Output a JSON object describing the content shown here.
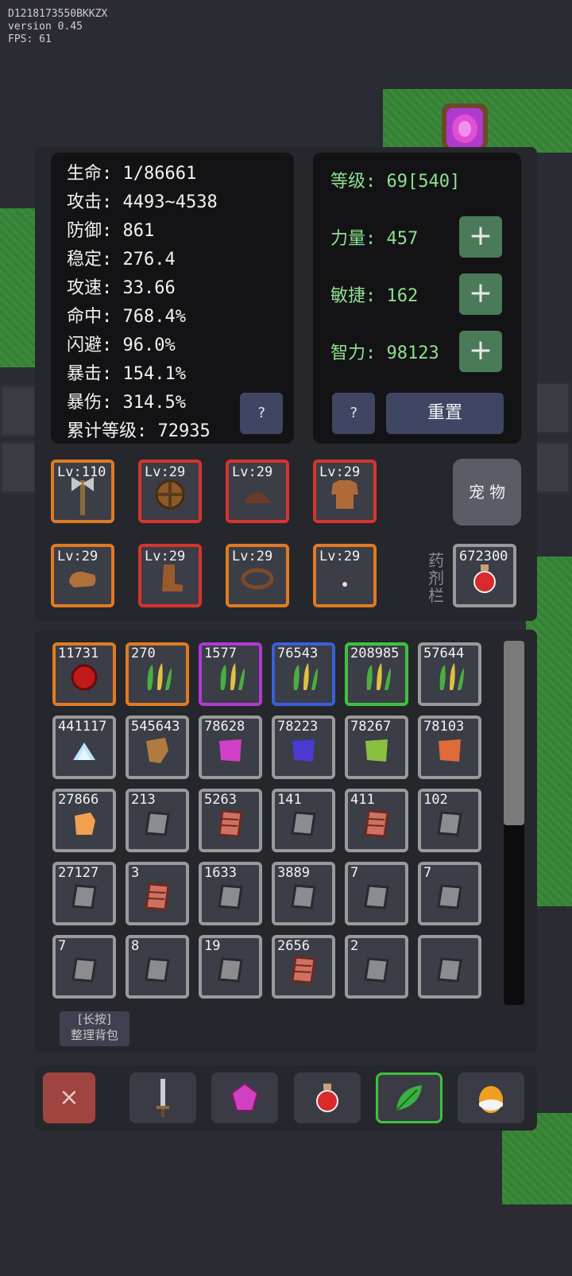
{
  "debug": {
    "line1": "D1218173550BKKZX",
    "line2": "version 0.45",
    "line3": "FPS: 61"
  },
  "stats": {
    "hp": "生命: 1/86661",
    "attack": "攻击: 4493~4538",
    "defense": "防御: 861",
    "stability": "稳定: 276.4",
    "attack_speed": "攻速: 33.66",
    "hit": "命中: 768.4%",
    "dodge": "闪避: 96.0%",
    "crit": "暴击: 154.1%",
    "crit_damage": "暴伤: 314.5%",
    "total_level": "累计等级: 72935",
    "help_label": "?"
  },
  "attributes": {
    "level": "等级: 69[540]",
    "strength": "力量: 457",
    "agility": "敏捷: 162",
    "intelligence": "智力: 98123",
    "plus_label": "+",
    "help_label": "?",
    "reset_label": "重置"
  },
  "equipment": [
    {
      "lv": "Lv:110",
      "icon": "axe-icon",
      "rarity": "orange"
    },
    {
      "lv": "Lv:29",
      "icon": "shield-icon",
      "rarity": "red"
    },
    {
      "lv": "Lv:29",
      "icon": "helmet-icon",
      "rarity": "red"
    },
    {
      "lv": "Lv:29",
      "icon": "armor-icon",
      "rarity": "red"
    },
    {
      "lv": "Lv:29",
      "icon": "glove-icon",
      "rarity": "orange"
    },
    {
      "lv": "Lv:29",
      "icon": "boot-icon",
      "rarity": "red"
    },
    {
      "lv": "Lv:29",
      "icon": "ring-icon",
      "rarity": "orange"
    },
    {
      "lv": "Lv:29",
      "icon": "necklace-icon",
      "rarity": "orange"
    }
  ],
  "pet_label": "宠 物",
  "potion_label": "药剂栏",
  "potion_count": "672300",
  "inventory": [
    {
      "count": "11731",
      "icon": "red-orb-icon",
      "rarity": "orange"
    },
    {
      "count": "270",
      "icon": "herb-icon",
      "rarity": "orange"
    },
    {
      "count": "1577",
      "icon": "herb-icon",
      "rarity": "purple"
    },
    {
      "count": "76543",
      "icon": "herb-icon",
      "rarity": "blue"
    },
    {
      "count": "208985",
      "icon": "herb-icon",
      "rarity": "green"
    },
    {
      "count": "57644",
      "icon": "herb-icon",
      "rarity": "gray"
    },
    {
      "count": "441117",
      "icon": "powder-icon",
      "rarity": "gray"
    },
    {
      "count": "545643",
      "icon": "leather-icon",
      "rarity": "gray"
    },
    {
      "count": "78628",
      "icon": "cloth-pink-icon",
      "rarity": "gray"
    },
    {
      "count": "78223",
      "icon": "cloth-blue-icon",
      "rarity": "gray"
    },
    {
      "count": "78267",
      "icon": "cloth-green-icon",
      "rarity": "gray"
    },
    {
      "count": "78103",
      "icon": "cloth-orange-icon",
      "rarity": "gray"
    },
    {
      "count": "27866",
      "icon": "ore-icon",
      "rarity": "gray"
    },
    {
      "count": "213",
      "icon": "stone-icon",
      "rarity": "gray"
    },
    {
      "count": "5263",
      "icon": "brick-icon",
      "rarity": "gray"
    },
    {
      "count": "141",
      "icon": "stone-icon",
      "rarity": "gray"
    },
    {
      "count": "411",
      "icon": "brick-icon",
      "rarity": "gray"
    },
    {
      "count": "102",
      "icon": "stone-icon",
      "rarity": "gray"
    },
    {
      "count": "27127",
      "icon": "stone-icon",
      "rarity": "gray"
    },
    {
      "count": "3",
      "icon": "brick-icon",
      "rarity": "gray"
    },
    {
      "count": "1633",
      "icon": "stone-icon",
      "rarity": "gray"
    },
    {
      "count": "3889",
      "icon": "stone-icon",
      "rarity": "gray"
    },
    {
      "count": "7",
      "icon": "stone-icon",
      "rarity": "gray"
    },
    {
      "count": "7",
      "icon": "stone-icon",
      "rarity": "gray"
    },
    {
      "count": "7",
      "icon": "stone-icon",
      "rarity": "gray"
    },
    {
      "count": "8",
      "icon": "stone-icon",
      "rarity": "gray"
    },
    {
      "count": "19",
      "icon": "stone-icon",
      "rarity": "gray"
    },
    {
      "count": "2656",
      "icon": "brick-icon",
      "rarity": "gray"
    },
    {
      "count": "2",
      "icon": "stone-icon",
      "rarity": "gray"
    },
    {
      "count": "",
      "icon": "stone-icon",
      "rarity": "gray"
    }
  ],
  "sort_button": {
    "line1": "[长按]",
    "line2": "整理背包"
  },
  "bottom_tabs": [
    {
      "name": "close",
      "label": "×"
    },
    {
      "name": "sword-tab",
      "icon": "sword-icon"
    },
    {
      "name": "gem-tab",
      "icon": "gem-icon"
    },
    {
      "name": "potion-tab",
      "icon": "potion-icon"
    },
    {
      "name": "herb-tab",
      "icon": "leaf-icon",
      "selected": true
    },
    {
      "name": "egg-tab",
      "icon": "egg-icon"
    }
  ],
  "colors": {
    "orange": "#e07a22",
    "red": "#d8332e",
    "purple": "#b03ad6",
    "blue": "#3a5fd8",
    "green": "#3ec23e",
    "gray": "#9a9a9a",
    "plus_button": "#4a7a58",
    "stat_green": "#8ee08e"
  }
}
